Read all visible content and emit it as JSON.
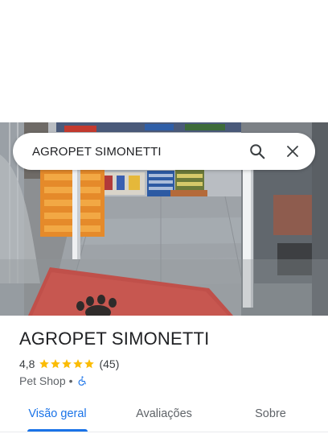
{
  "search": {
    "query": "AGROPET SIMONETTI",
    "search_icon": "search-icon",
    "close_icon": "close-icon"
  },
  "place": {
    "name": "AGROPET SIMONETTI",
    "rating": "4,8",
    "stars_filled": 5,
    "reviews": "(45)",
    "category": "Pet Shop",
    "separator": "•",
    "accessibility_icon": "wheelchair-icon"
  },
  "tabs": [
    {
      "label": "Visão geral",
      "active": true
    },
    {
      "label": "Avaliações",
      "active": false
    },
    {
      "label": "Sobre",
      "active": false
    }
  ],
  "colors": {
    "accent": "#1a73e8",
    "star": "#fbbc04",
    "mat": "#c0504a"
  }
}
